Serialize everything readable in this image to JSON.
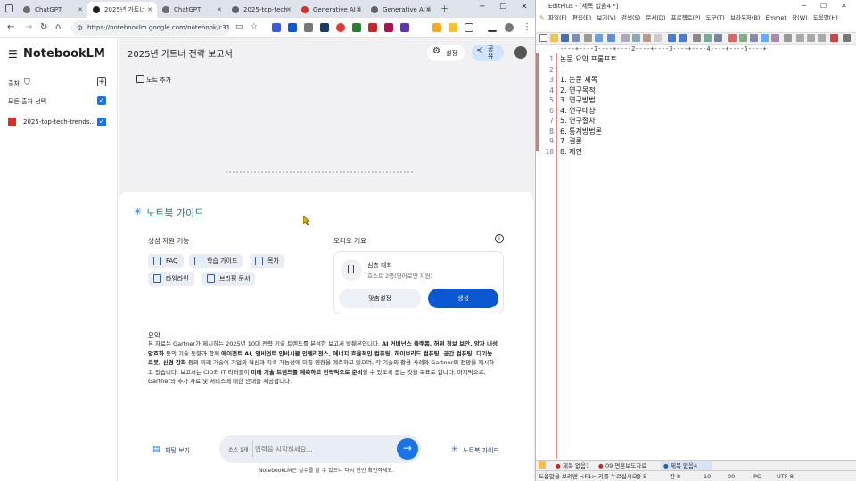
{
  "browser": {
    "tabs": [
      {
        "label": "ChatGPT",
        "color": "#6b6b6b"
      },
      {
        "label": "2025년 가트너",
        "color": "#202124"
      },
      {
        "label": "ChatGPT",
        "color": "#6b6b6b"
      },
      {
        "label": "2025-top-tech",
        "color": "#5f6368"
      },
      {
        "label": "Generative AI ii",
        "color": "#d93025"
      },
      {
        "label": "Generative AI ii",
        "color": "#5f6368"
      }
    ],
    "url": "https://notebooklm.google.com/notebook/c316d..."
  },
  "notebook": {
    "app_name": "NotebookLM",
    "title": "2025년 가트너 전략 보고서",
    "settings_label": "설정",
    "share_label": "공유",
    "sources_label": "출처",
    "select_all_label": "모든 출처 선택",
    "source_item": "2025-top-tech-trends...",
    "add_note_label": "노트 추가",
    "guide_title": "노트북 가이드",
    "gen_features_label": "생성 지원 기능",
    "chips": [
      "FAQ",
      "학습 가이드",
      "목차",
      "타임라인",
      "브리핑 문서"
    ],
    "audio_label": "오디오 개요",
    "deep_dive_title": "심층 대화",
    "deep_dive_sub": "호스트 2명(영어로만 지원)",
    "customize_label": "맞춤설정",
    "generate_label": "생성",
    "summary_heading": "요약",
    "summary_p1": "본 자료는 Gartner가 제시하는 2025년 10대 전략 기술 트렌드를 분석한 보고서 발췌본입니다. ",
    "summary_b1": "AI 거버넌스 플랫폼, 허위 정보 보안, 양자 내성 암호화",
    "summary_p2": " 등의 기술 동향과 함께 ",
    "summary_b2": "에이전트 AI, 앰비언트 인비시블 인텔리전스, 에너지 효율적인 컴퓨팅, 하이브리드 컴퓨팅, 공간 컴퓨팅, 다기능 로봇, 신경 강화",
    "summary_p3": " 등의 미래 기술이 기업의 혁신과 지속 가능성에 미칠 영향을 예측하고 있으며, 각 기술의 활용 사례와 Gartner의 전망을 제시하고 있습니다. 보고서는 CIO와 IT 리더들이 ",
    "summary_b3": "미래 기술 트렌드를 예측하고 전략적으로 준비",
    "summary_p4": "할 수 있도록 돕는 것을 목표로 합니다. 마지막으로, Gartner의 추가 자료 및 서비스에 대한 안내를 제공합니다.",
    "chat_view_label": "채팅 보기",
    "source_count": "소스 1개",
    "input_placeholder": "입력을 시작하세요...",
    "guide_button_label": "노트북 가이드",
    "disclaimer": "NotebookLM은 실수를 할 수 있으니 다시 한번 확인하세요."
  },
  "editplus": {
    "title": "EditPlus - [제목 없음4 *]",
    "menu": [
      "파일(F)",
      "편집(E)",
      "보기(V)",
      "검색(S)",
      "문서(D)",
      "프로젝트(P)",
      "도구(T)",
      "브라우저(B)",
      "Emmet",
      "창(W)",
      "도움말(H)"
    ],
    "ruler": "----+----1----+----2----+----3----+----4----+----5----+",
    "lines": [
      {
        "n": "1",
        "text": "논문 요약 프롬프트"
      },
      {
        "n": "2",
        "text": ""
      },
      {
        "n": "3",
        "text": "1. 논문 제목"
      },
      {
        "n": "4",
        "text": "2. 연구목적"
      },
      {
        "n": "5",
        "text": "3. 연구방법"
      },
      {
        "n": "6",
        "text": "4. 연구대상"
      },
      {
        "n": "7",
        "text": "5. 연구절차"
      },
      {
        "n": "8",
        "text": "6. 통계방법론"
      },
      {
        "n": "9",
        "text": "7. 결론"
      },
      {
        "n": "10",
        "text": "8. 제언"
      }
    ],
    "doc_tabs": [
      "제목 없음1",
      "09 면훈보도자료",
      "제목 없음4"
    ],
    "status": {
      "help": "도움말을 보려면 <F1> 키를 누르십시오.",
      "line": "줄 5",
      "col": "칸 8",
      "num": "10",
      "num2": "00",
      "pc": "PC",
      "enc": "UTF-8"
    }
  }
}
